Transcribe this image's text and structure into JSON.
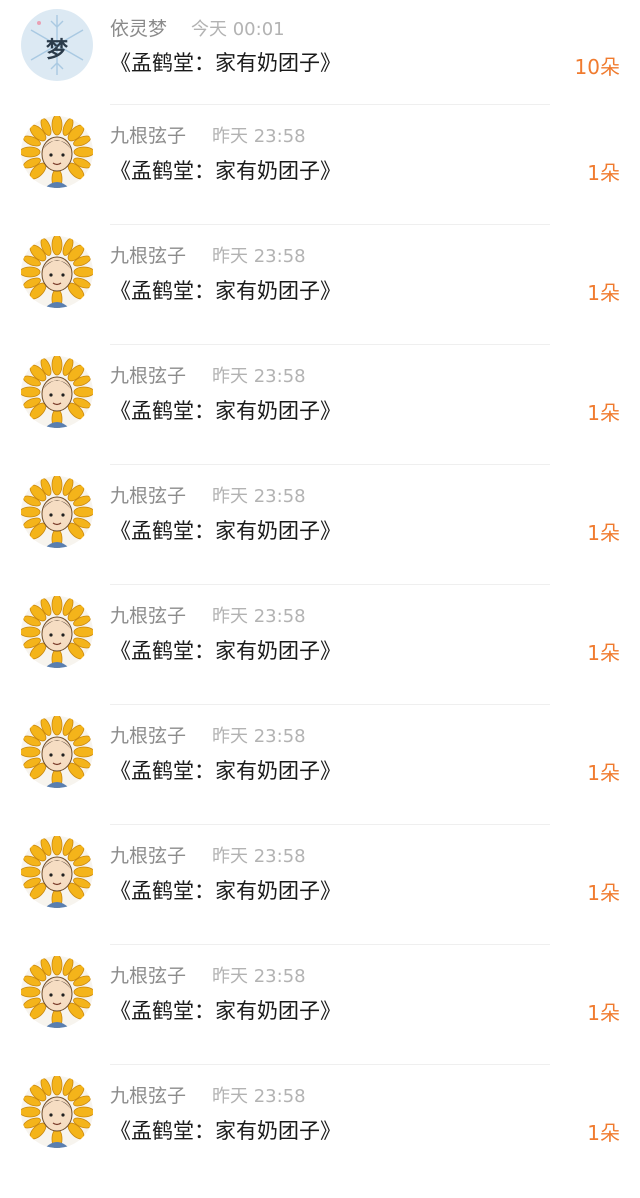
{
  "colors": {
    "name": "#8c8c8c",
    "time": "#b3b3b3",
    "title": "#1a1a1a",
    "count": "#f07b2f",
    "divider": "#efefef"
  },
  "rows": [
    {
      "avatar": "snowflake-dream-avatar",
      "name": "依灵梦",
      "time": "今天 00:01",
      "title": "《孟鹤堂：家有奶团子》",
      "count": "10朵",
      "avatar_text": "梦"
    },
    {
      "avatar": "sunflower-avatar",
      "name": "九根弦子",
      "time": "昨天 23:58",
      "title": "《孟鹤堂：家有奶团子》",
      "count": "1朵"
    },
    {
      "avatar": "sunflower-avatar",
      "name": "九根弦子",
      "time": "昨天 23:58",
      "title": "《孟鹤堂：家有奶团子》",
      "count": "1朵"
    },
    {
      "avatar": "sunflower-avatar",
      "name": "九根弦子",
      "time": "昨天 23:58",
      "title": "《孟鹤堂：家有奶团子》",
      "count": "1朵"
    },
    {
      "avatar": "sunflower-avatar",
      "name": "九根弦子",
      "time": "昨天 23:58",
      "title": "《孟鹤堂：家有奶团子》",
      "count": "1朵"
    },
    {
      "avatar": "sunflower-avatar",
      "name": "九根弦子",
      "time": "昨天 23:58",
      "title": "《孟鹤堂：家有奶团子》",
      "count": "1朵"
    },
    {
      "avatar": "sunflower-avatar",
      "name": "九根弦子",
      "time": "昨天 23:58",
      "title": "《孟鹤堂：家有奶团子》",
      "count": "1朵"
    },
    {
      "avatar": "sunflower-avatar",
      "name": "九根弦子",
      "time": "昨天 23:58",
      "title": "《孟鹤堂：家有奶团子》",
      "count": "1朵"
    },
    {
      "avatar": "sunflower-avatar",
      "name": "九根弦子",
      "time": "昨天 23:58",
      "title": "《孟鹤堂：家有奶团子》",
      "count": "1朵"
    },
    {
      "avatar": "sunflower-avatar",
      "name": "九根弦子",
      "time": "昨天 23:58",
      "title": "《孟鹤堂：家有奶团子》",
      "count": "1朵"
    }
  ]
}
